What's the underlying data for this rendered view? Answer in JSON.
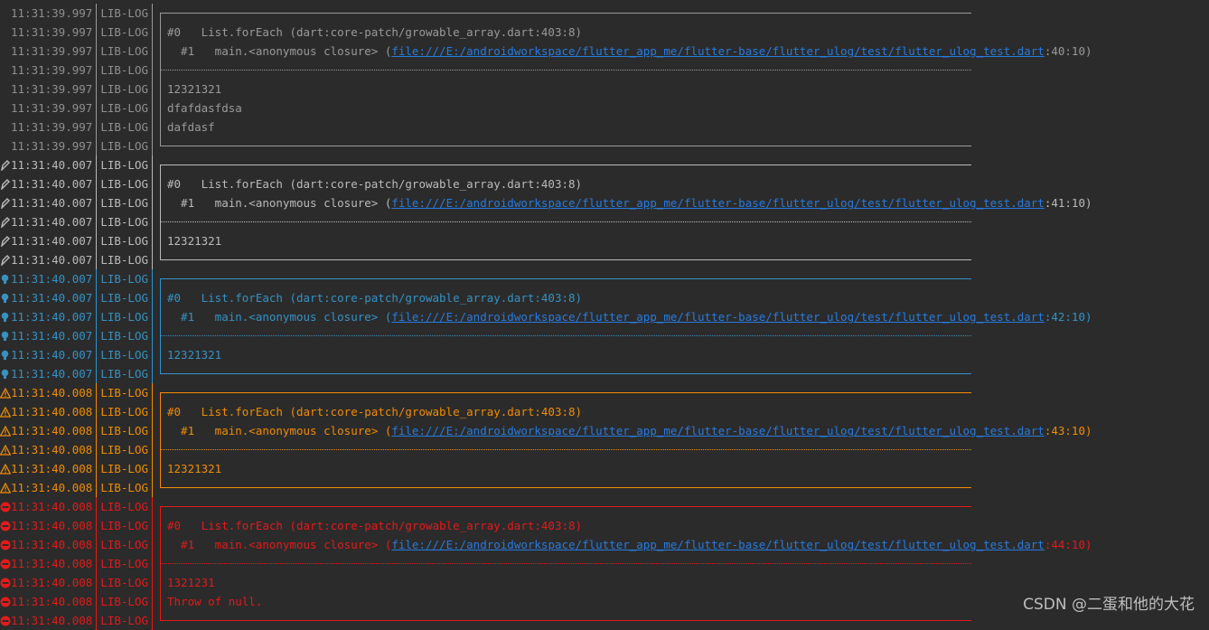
{
  "watermark": "CSDN @二蛋和他的大花",
  "colors": {
    "verbose": "#9a9a9a",
    "debug": "#bbbbbb",
    "info": "#3592c4",
    "warn": "#f08d00",
    "error": "#e41a1a",
    "link": "#287bde",
    "background": "#2b2b2b"
  },
  "tag": "LIB-LOG",
  "groups": [
    {
      "level": "verbose",
      "icon": "none",
      "timestamp": "11:31:39.997",
      "frame0": "#0   List.forEach (dart:core-patch/growable_array.dart:403:8)",
      "frame1_prefix": "  #1   main.<anonymous closure> (",
      "frame1_link": "file:///E:/androidworkspace/flutter_app_me/flutter-base/flutter_ulog/test/flutter_ulog_test.dart",
      "frame1_suffix": ":40:10)",
      "messages": [
        "12321321",
        "dfafdasfdsa",
        "dafdasf"
      ],
      "closed": true
    },
    {
      "level": "debug",
      "icon": "pen-icon",
      "timestamp": "11:31:40.007",
      "frame0": "#0   List.forEach (dart:core-patch/growable_array.dart:403:8)",
      "frame1_prefix": "  #1   main.<anonymous closure> (",
      "frame1_link": "file:///E:/androidworkspace/flutter_app_me/flutter-base/flutter_ulog/test/flutter_ulog_test.dart",
      "frame1_suffix": ":41:10)",
      "messages": [
        "12321321"
      ],
      "closed": true
    },
    {
      "level": "info",
      "icon": "bulb-icon",
      "timestamp": "11:31:40.007",
      "frame0": "#0   List.forEach (dart:core-patch/growable_array.dart:403:8)",
      "frame1_prefix": "  #1   main.<anonymous closure> (",
      "frame1_link": "file:///E:/androidworkspace/flutter_app_me/flutter-base/flutter_ulog/test/flutter_ulog_test.dart",
      "frame1_suffix": ":42:10)",
      "messages": [
        "12321321"
      ],
      "closed": true
    },
    {
      "level": "warn",
      "icon": "warning-icon",
      "timestamp": "11:31:40.008",
      "frame0": "#0   List.forEach (dart:core-patch/growable_array.dart:403:8)",
      "frame1_prefix": "  #1   main.<anonymous closure> (",
      "frame1_link": "file:///E:/androidworkspace/flutter_app_me/flutter-base/flutter_ulog/test/flutter_ulog_test.dart",
      "frame1_suffix": ":43:10)",
      "messages": [
        "12321321"
      ],
      "closed": true
    },
    {
      "level": "error",
      "icon": "error-icon",
      "timestamp": "11:31:40.008",
      "frame0": "#0   List.forEach (dart:core-patch/growable_array.dart:403:8)",
      "frame1_prefix": "  #1   main.<anonymous closure> (",
      "frame1_link": "file:///E:/androidworkspace/flutter_app_me/flutter-base/flutter_ulog/test/flutter_ulog_test.dart",
      "frame1_suffix": ":44:10)",
      "messages": [
        "1321231",
        "Throw of null."
      ],
      "closed": true
    }
  ]
}
